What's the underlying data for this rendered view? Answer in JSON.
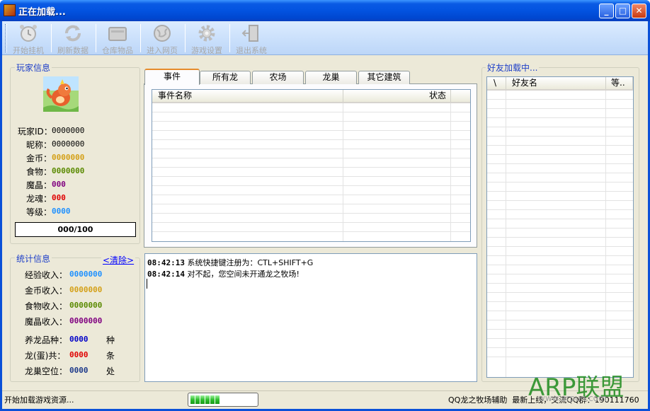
{
  "window": {
    "title": "正在加载..."
  },
  "toolbar": {
    "items": [
      {
        "label": "开始挂机",
        "icon": "alarm-clock-icon"
      },
      {
        "label": "刷新数据",
        "icon": "refresh-icon"
      },
      {
        "label": "仓库物品",
        "icon": "warehouse-icon"
      },
      {
        "label": "进入网页",
        "icon": "globe-icon"
      },
      {
        "label": "游戏设置",
        "icon": "gear-icon"
      },
      {
        "label": "退出系统",
        "icon": "exit-door-icon"
      }
    ]
  },
  "player": {
    "legend": "玩家信息",
    "fields": [
      {
        "label": "玩家ID：",
        "value": "0000000",
        "color": "#000000"
      },
      {
        "label": "昵称：",
        "value": "0000000",
        "color": "#000000"
      },
      {
        "label": "金币：",
        "value": "0000000",
        "color": "#d4a017"
      },
      {
        "label": "食物：",
        "value": "0000000",
        "color": "#5a8a00"
      },
      {
        "label": "魔晶：",
        "value": "000",
        "color": "#800080"
      },
      {
        "label": "龙魂：",
        "value": "000",
        "color": "#e00000"
      },
      {
        "label": "等级：",
        "value": "0000",
        "color": "#1e90ff"
      }
    ],
    "progress": "000/100"
  },
  "stats": {
    "legend": "统计信息",
    "clear_link": "<清除>",
    "income": [
      {
        "label": "经验收入：",
        "value": "0000000",
        "color": "#1e90ff"
      },
      {
        "label": "金币收入：",
        "value": "0000000",
        "color": "#d4a017"
      },
      {
        "label": "食物收入：",
        "value": "0000000",
        "color": "#5a8a00"
      },
      {
        "label": "魔晶收入：",
        "value": "0000000",
        "color": "#800080"
      }
    ],
    "counts": [
      {
        "label": "养龙品种：",
        "value": "0000",
        "unit": "种",
        "color": "#0000c8"
      },
      {
        "label": "龙(蛋)共：",
        "value": "0000",
        "unit": "条",
        "color": "#e00000"
      },
      {
        "label": "龙巢空位：",
        "value": "0000",
        "unit": "处",
        "color": "#1e3a8a"
      }
    ]
  },
  "tabs": [
    {
      "label": "事件",
      "active": true
    },
    {
      "label": "所有龙",
      "active": false
    },
    {
      "label": "农场",
      "active": false
    },
    {
      "label": "龙巢",
      "active": false
    },
    {
      "label": "其它建筑",
      "active": false
    }
  ],
  "events_table": {
    "columns": [
      "事件名称",
      "状态"
    ]
  },
  "log": [
    {
      "time": "08:42:13",
      "text": "系统快捷键注册为：CTL+SHIFT+G"
    },
    {
      "time": "08:42:14",
      "text": "对不起，您空间未开通龙之牧场!"
    }
  ],
  "friends": {
    "legend": "好友加载中...",
    "columns": [
      "\\",
      "好友名",
      "等.."
    ]
  },
  "status": {
    "left": "开始加载游戏资源...",
    "progress_fraction": 0.44,
    "right": "QQ龙之牧场辅助  最新上线，交流QQ群：190111760"
  },
  "watermark": {
    "text": "ARP联盟",
    "url": "www.arpun.com"
  }
}
